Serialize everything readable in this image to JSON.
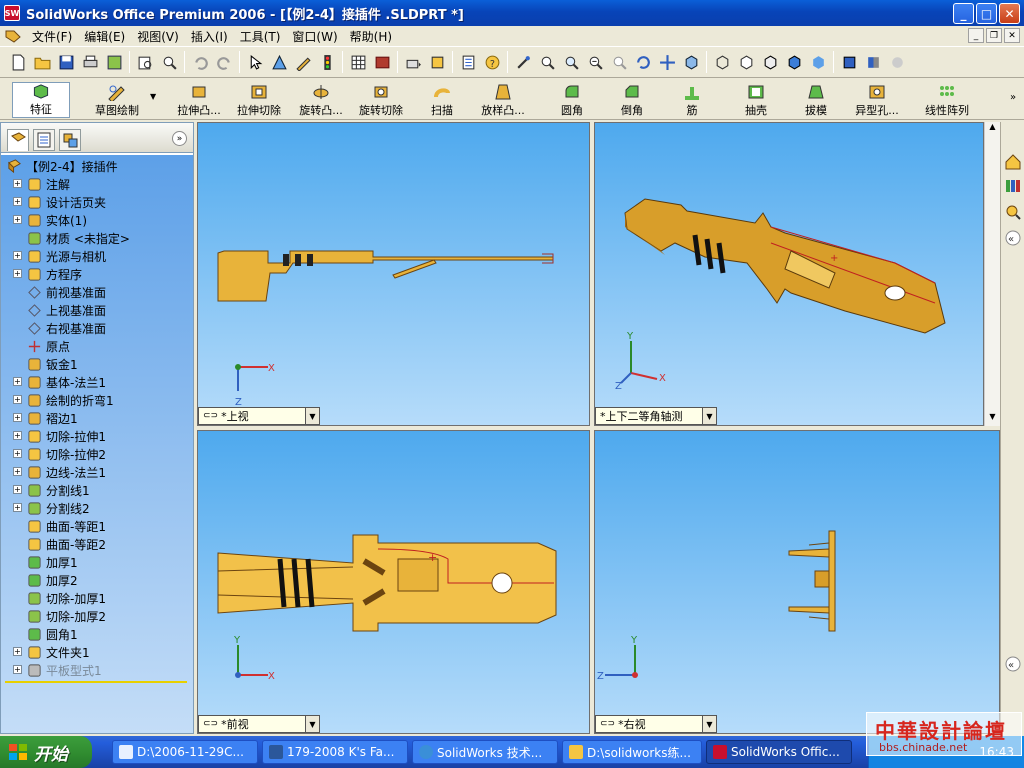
{
  "window": {
    "title": "SolidWorks Office Premium 2006 - [【例2-4】接插件 .SLDPRT *]",
    "app_badge": "SW"
  },
  "menu": [
    "文件(F)",
    "编辑(E)",
    "视图(V)",
    "插入(I)",
    "工具(T)",
    "窗口(W)",
    "帮助(H)"
  ],
  "feature_toolbar": {
    "buttons": [
      "特征",
      "草图绘制",
      "拉伸凸...",
      "拉伸切除",
      "旋转凸...",
      "旋转切除",
      "扫描",
      "放样凸...",
      "圆角",
      "倒角",
      "筋",
      "抽壳",
      "拔模",
      "异型孔...",
      "线性阵列"
    ]
  },
  "feature_tree": {
    "root": "【例2-4】接插件",
    "items": [
      {
        "label": "注解"
      },
      {
        "label": "设计活页夹"
      },
      {
        "label": "实体(1)"
      },
      {
        "label": "材质 <未指定>"
      },
      {
        "label": "光源与相机"
      },
      {
        "label": "方程序"
      },
      {
        "label": "前视基准面"
      },
      {
        "label": "上视基准面"
      },
      {
        "label": "右视基准面"
      },
      {
        "label": "原点"
      },
      {
        "label": "钣金1"
      },
      {
        "label": "基体-法兰1"
      },
      {
        "label": "绘制的折弯1"
      },
      {
        "label": "褶边1"
      },
      {
        "label": "切除-拉伸1"
      },
      {
        "label": "切除-拉伸2"
      },
      {
        "label": "边线-法兰1"
      },
      {
        "label": "分割线1"
      },
      {
        "label": "分割线2"
      },
      {
        "label": "曲面-等距1"
      },
      {
        "label": "曲面-等距2"
      },
      {
        "label": "加厚1"
      },
      {
        "label": "加厚2"
      },
      {
        "label": "切除-加厚1"
      },
      {
        "label": "切除-加厚2"
      },
      {
        "label": "圆角1"
      },
      {
        "label": "文件夹1"
      },
      {
        "label": "平板型式1"
      }
    ]
  },
  "viewports": {
    "top": "*上视",
    "iso": "*上下二等角轴测",
    "front": "*前视",
    "right": "*右视"
  },
  "taskbar": {
    "start": "开始",
    "tasks": [
      "D:\\2006-11-29C...",
      "179-2008 K's Fa...",
      "SolidWorks 技术...",
      "D:\\solidworks练...",
      "SolidWorks Offic..."
    ],
    "clock": "16:43"
  },
  "watermark": {
    "title": "中華設計論壇",
    "url": "bbs.chinade.net"
  },
  "colors": {
    "part": "#E8B33A",
    "part_edge": "#6B4410",
    "viewport_top": "#4EA9EE",
    "viewport_bottom": "#B6DCFA",
    "title_bar": "#0A5FD8",
    "taskbar": "#245EDC"
  }
}
